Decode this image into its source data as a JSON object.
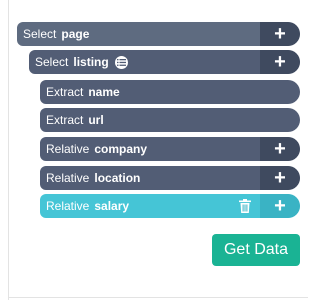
{
  "selectors": [
    {
      "kind": "Select",
      "name": "page",
      "has_list_icon": false,
      "has_add": true,
      "has_delete": false,
      "style": "top"
    },
    {
      "kind": "Select",
      "name": "listing",
      "has_list_icon": true,
      "has_add": true,
      "has_delete": false,
      "style": "dark"
    },
    {
      "kind": "Extract",
      "name": "name",
      "has_list_icon": false,
      "has_add": false,
      "has_delete": false,
      "style": "dark"
    },
    {
      "kind": "Extract",
      "name": "url",
      "has_list_icon": false,
      "has_add": false,
      "has_delete": false,
      "style": "dark"
    },
    {
      "kind": "Relative",
      "name": "company",
      "has_list_icon": false,
      "has_add": true,
      "has_delete": false,
      "style": "dark"
    },
    {
      "kind": "Relative",
      "name": "location",
      "has_list_icon": false,
      "has_add": true,
      "has_delete": false,
      "style": "dark"
    },
    {
      "kind": "Relative",
      "name": "salary",
      "has_list_icon": false,
      "has_add": true,
      "has_delete": true,
      "style": "active"
    }
  ],
  "icons": {
    "add": "plus-icon",
    "delete": "trash-icon",
    "list": "list-icon"
  },
  "add_glyph": "+",
  "get_data_label": "Get Data",
  "colors": {
    "row": "#525d75",
    "active_row": "#45c5d6",
    "get_data": "#1ab394"
  }
}
